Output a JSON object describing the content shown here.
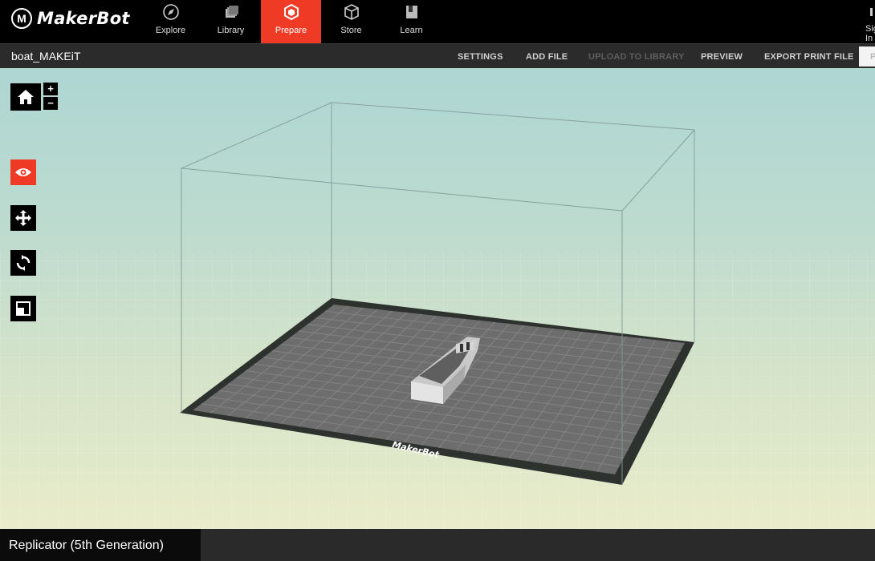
{
  "app": {
    "brand": "MakerBot"
  },
  "nav": {
    "items": [
      {
        "label": "Explore",
        "icon": "compass-icon"
      },
      {
        "label": "Library",
        "icon": "library-icon"
      },
      {
        "label": "Prepare",
        "icon": "prepare-cube-icon",
        "active": true
      },
      {
        "label": "Store",
        "icon": "store-box-icon"
      },
      {
        "label": "Learn",
        "icon": "learn-book-icon"
      }
    ],
    "signin_label": "Sign In"
  },
  "subbar": {
    "file_name": "boat_MAKEiT",
    "actions": [
      {
        "label": "SETTINGS",
        "enabled": true
      },
      {
        "label": "ADD FILE",
        "enabled": true
      },
      {
        "label": "UPLOAD TO LIBRARY",
        "enabled": false
      },
      {
        "label": "PREVIEW",
        "enabled": true
      },
      {
        "label": "EXPORT PRINT FILE",
        "enabled": true
      }
    ],
    "print_label": "P"
  },
  "tools": {
    "zoom_in": "+",
    "zoom_out": "−",
    "items": [
      {
        "name": "home-view",
        "icon": "home-icon"
      },
      {
        "name": "look",
        "icon": "eye-icon",
        "active": true
      },
      {
        "name": "move",
        "icon": "move-arrows-icon"
      },
      {
        "name": "rotate",
        "icon": "rotate-icon"
      },
      {
        "name": "scale",
        "icon": "scale-icon"
      }
    ]
  },
  "build_plate": {
    "brand_label": "MakerBot"
  },
  "status": {
    "printer": "Replicator (5th Generation)"
  },
  "colors": {
    "accent": "#ef3a26",
    "nav_bg": "#000000",
    "subbar_bg": "#2b2b2b",
    "plate": "#6a6a6a"
  }
}
